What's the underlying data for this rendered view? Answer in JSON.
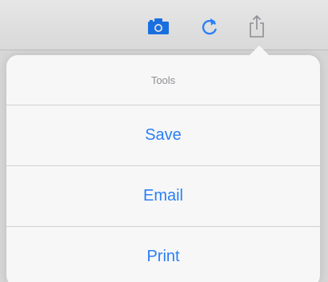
{
  "toolbar": {
    "icons": [
      "camera-icon",
      "refresh-icon",
      "share-icon"
    ],
    "camera_color": "#1a6fe0",
    "refresh_color": "#2a7ff5",
    "share_color": "#8e8e93"
  },
  "popover": {
    "title": "Tools",
    "items": [
      {
        "label": "Save"
      },
      {
        "label": "Email"
      },
      {
        "label": "Print"
      }
    ],
    "accent_color": "#2a7ff5"
  }
}
